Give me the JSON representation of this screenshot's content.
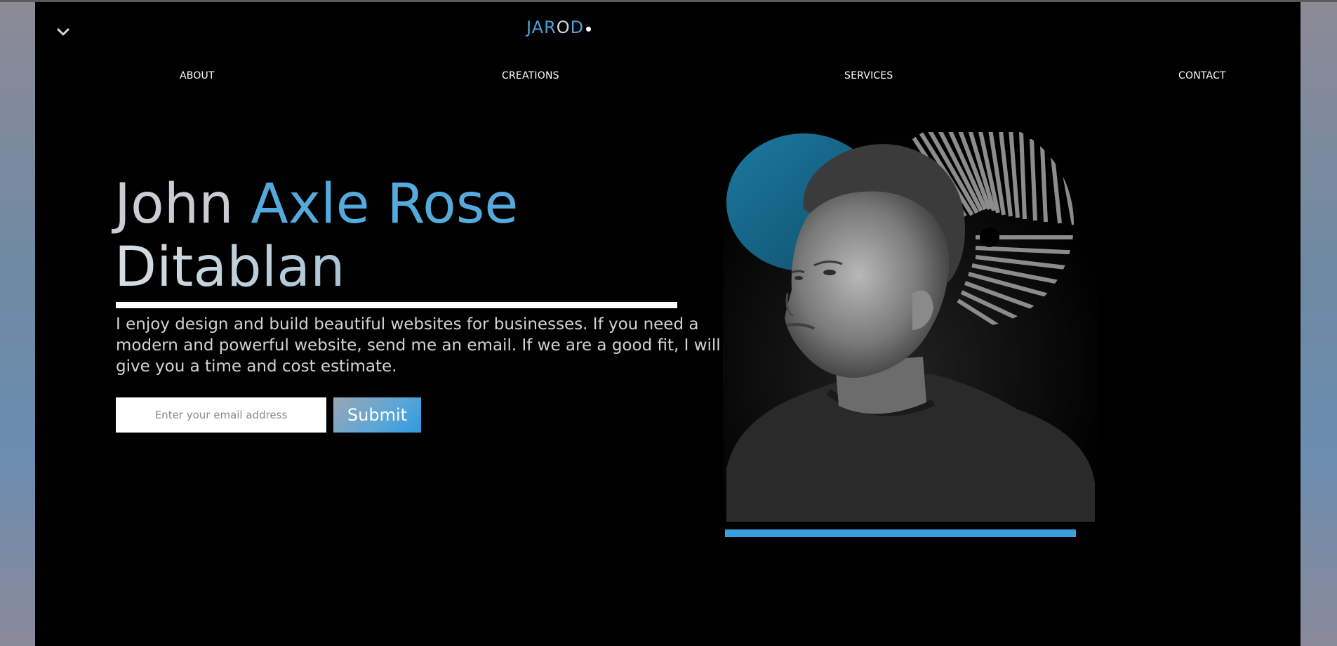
{
  "logo": {
    "part1": "JAR",
    "part2": "O",
    "part3": "D"
  },
  "nav": {
    "items": [
      "ABOUT",
      "CREATIONS",
      "SERVICES",
      "CONTACT"
    ]
  },
  "hero": {
    "title_first": "John",
    "title_middle": "Axle Rose",
    "title_last": "Ditablan",
    "description": "I enjoy design and build beautiful websites for businesses. If you need a modern and powerful website, send me an email. If we are a good fit, I will give you a time and cost estimate.",
    "email_placeholder": "Enter your email address",
    "submit_label": "Submit"
  },
  "icons": {
    "menu_toggle": "chevron-down-icon"
  },
  "colors": {
    "accent": "#3a9ee0",
    "page_background": "#000000",
    "teal_circle": "#1b6f92"
  }
}
